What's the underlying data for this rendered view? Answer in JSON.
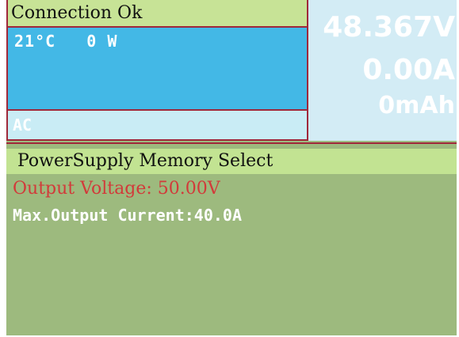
{
  "status": {
    "connection_text": "Connection Ok",
    "temperature": "21°C",
    "power": "0 W",
    "source": "AC"
  },
  "measurements": {
    "voltage": "48.367V",
    "current": "0.00A",
    "charge": "0mAh"
  },
  "memory": {
    "title": "PowerSupply Memory Select",
    "output_voltage": "Output Voltage: 50.00V",
    "max_output_current": "Max.Output Current:40.0A"
  },
  "colors": {
    "panel_background": "#9dba7e",
    "header_green": "#c2e392",
    "status_blue": "#43b8e6",
    "border_red": "#a0283a",
    "highlight_red": "#d23a3a"
  }
}
